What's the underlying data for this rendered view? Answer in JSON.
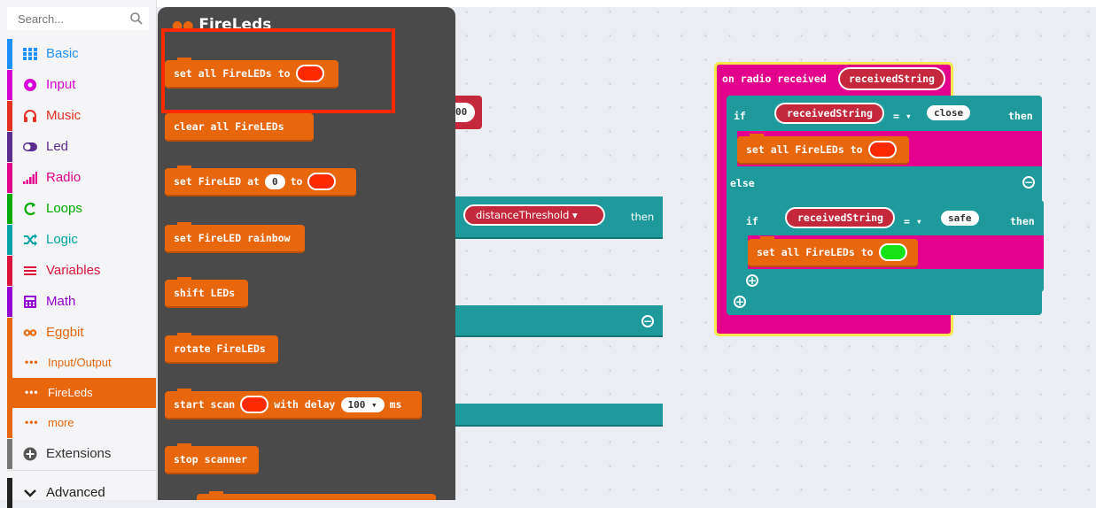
{
  "search": {
    "placeholder": "Search..."
  },
  "categories": [
    {
      "label": "Basic",
      "color": "#1e90ff",
      "icon": "grid-icon"
    },
    {
      "label": "Input",
      "color": "#d400d4",
      "icon": "circle-dot-icon"
    },
    {
      "label": "Music",
      "color": "#e63022",
      "icon": "headphones-icon"
    },
    {
      "label": "Led",
      "color": "#5c2d91",
      "icon": "toggle-icon"
    },
    {
      "label": "Radio",
      "color": "#e3008c",
      "icon": "signal-bars-icon"
    },
    {
      "label": "Loops",
      "color": "#00aa00",
      "icon": "loop-arrow-icon"
    },
    {
      "label": "Logic",
      "color": "#00a4a6",
      "icon": "shuffle-icon"
    },
    {
      "label": "Variables",
      "color": "#dc143c",
      "icon": "lines-icon"
    },
    {
      "label": "Math",
      "color": "#9400d3",
      "icon": "calculator-icon"
    },
    {
      "label": "Eggbit",
      "color": "#e8660c",
      "icon": "glasses-icon"
    }
  ],
  "subcategories": [
    "Input/Output",
    "FireLeds",
    "more"
  ],
  "extensions_label": "Extensions",
  "advanced_label": "Advanced",
  "flyout": {
    "title": "FireLeds",
    "blocks": {
      "set_all": "set all FireLEDs to",
      "clear_all": "clear all FireLEDs",
      "set_at": "set FireLED at",
      "set_at_index": "0",
      "set_at_to": "to",
      "rainbow": "set FireLED rainbow",
      "shift": "shift LEDs",
      "rotate": "rotate FireLEDs",
      "scan_start": "start scan",
      "scan_with": "with delay",
      "scan_delay": "100 ▾",
      "scan_ms": "ms",
      "stop": "stop scanner"
    }
  },
  "workspace": {
    "partial_value": "00",
    "distance_var": "distanceThreshold ▾",
    "then": "then",
    "radio": {
      "event": "on radio received",
      "param": "receivedString",
      "if": "if",
      "var": "receivedString",
      "op": "= ▾",
      "close": "close",
      "then": "then",
      "set_all": "set all FireLEDs to",
      "else": "else",
      "safe": "safe"
    }
  },
  "colors": {
    "fireleds": "#e8660c",
    "radio": "#e3008c",
    "logic": "#1e9a9d",
    "variable": "#c4283a",
    "highlight": "#ff2a00",
    "selection": "#f7e84b"
  }
}
